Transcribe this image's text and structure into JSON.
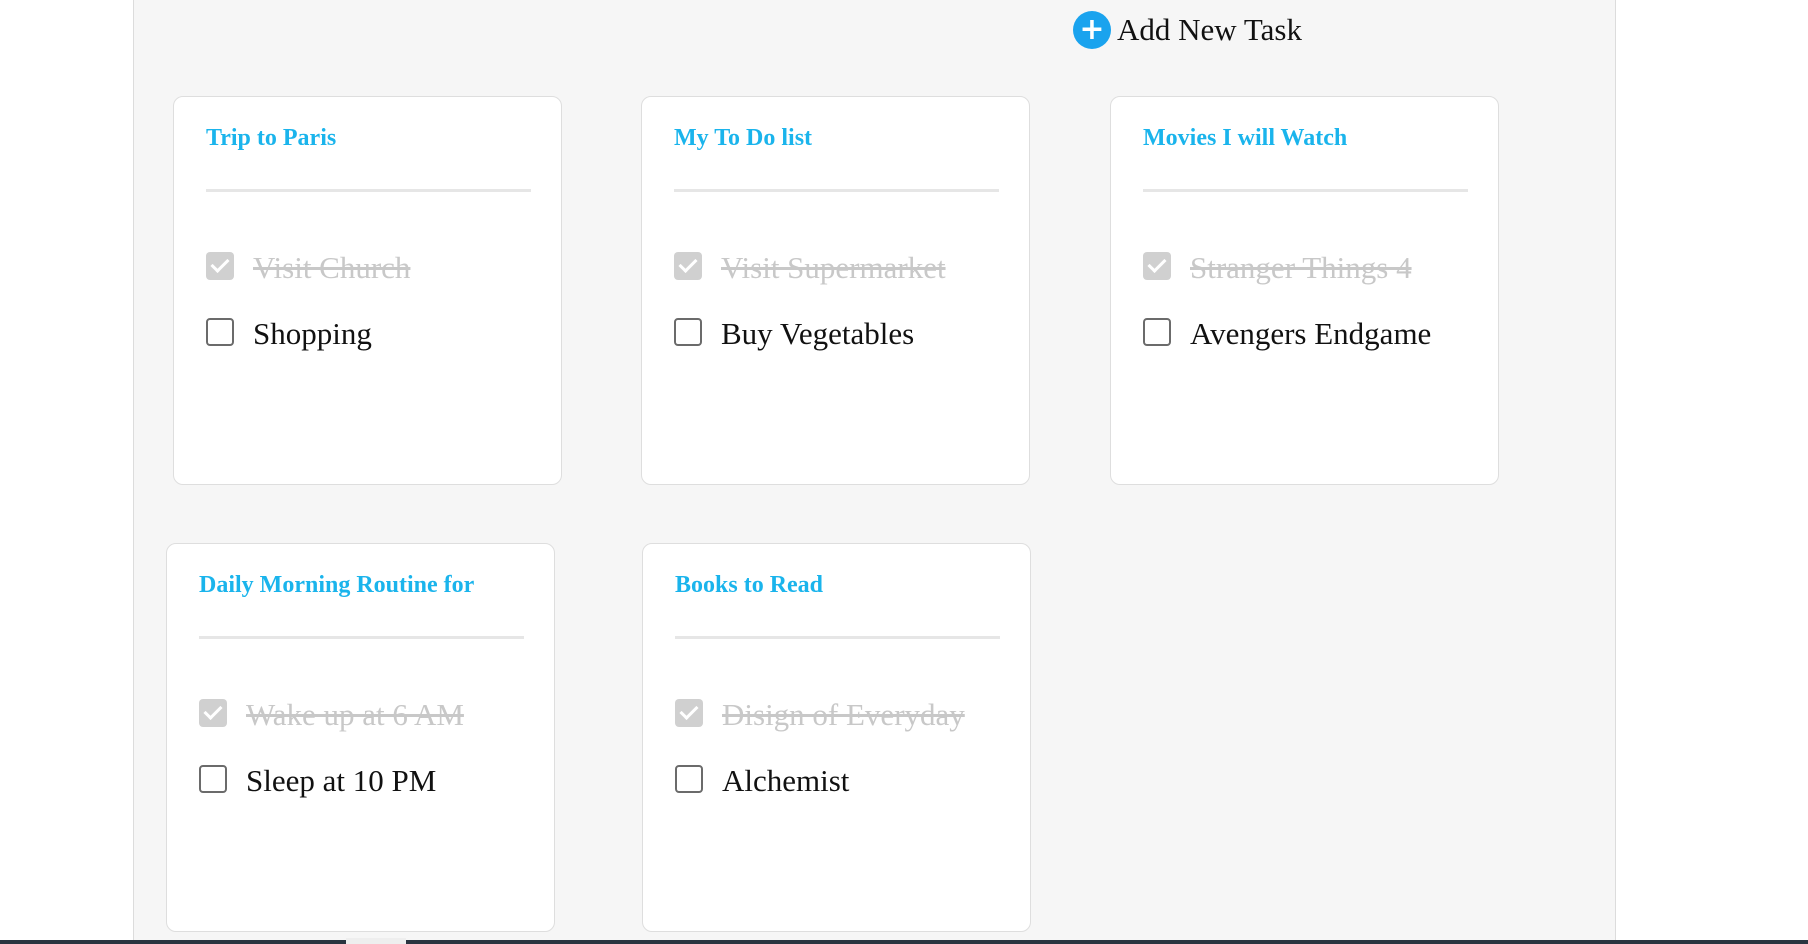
{
  "header": {
    "add_label": "Add New Task",
    "add_icon": "plus-circle-icon"
  },
  "colors": {
    "accent": "#1ab4ec",
    "board_bg": "#f6f6f6",
    "done_text": "#c8c8c8"
  },
  "cards": [
    {
      "title": "Trip to Paris",
      "tasks": [
        {
          "label": "Visit Church",
          "done": true
        },
        {
          "label": "Shopping",
          "done": false
        }
      ]
    },
    {
      "title": "My To Do list",
      "tasks": [
        {
          "label": "Visit Supermarket",
          "done": true
        },
        {
          "label": "Buy Vegetables",
          "done": false
        }
      ]
    },
    {
      "title": "Movies I will Watch",
      "tasks": [
        {
          "label": "Stranger Things 4",
          "done": true
        },
        {
          "label": "Avengers Endgame",
          "done": false
        }
      ]
    },
    {
      "title": "Daily Morning Routine for",
      "tasks": [
        {
          "label": "Wake up at 6 AM",
          "done": true
        },
        {
          "label": "Sleep at 10 PM",
          "done": false
        }
      ]
    },
    {
      "title": "Books to Read",
      "tasks": [
        {
          "label": "Disign of Everyday",
          "done": true
        },
        {
          "label": "Alchemist",
          "done": false
        }
      ]
    }
  ]
}
